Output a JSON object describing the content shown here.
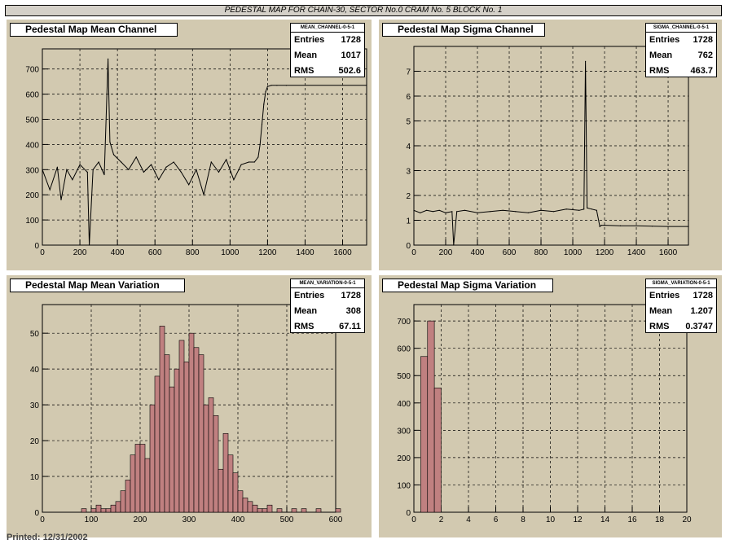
{
  "banner": "PEDESTAL MAP FOR CHAIN-30, SECTOR No.0 CRAM No. 5 BLOCK No. 1",
  "footer": "Printed: 12/31/2002",
  "colors": {
    "pad_bg": "#d2c9b0",
    "hist_fill": "#c08080",
    "line": "#000000"
  },
  "pads": [
    {
      "title": "Pedestal Map Mean Channel",
      "stats": {
        "name": "MEAN_CHANNEL-0-5-1",
        "entries_label": "Entries",
        "entries": "1728",
        "mean_label": "Mean",
        "mean": "1017",
        "rms_label": "RMS",
        "rms": "502.6"
      }
    },
    {
      "title": "Pedestal Map Sigma Channel",
      "stats": {
        "name": "SIGMA_CHANNEL-0-5-1",
        "entries_label": "Entries",
        "entries": "1728",
        "mean_label": "Mean",
        "mean": "762",
        "rms_label": "RMS",
        "rms": "463.7"
      }
    },
    {
      "title": "Pedestal Map Mean Variation",
      "stats": {
        "name": "MEAN_VARIATION-0-5-1",
        "entries_label": "Entries",
        "entries": "1728",
        "mean_label": "Mean",
        "mean": "308",
        "rms_label": "RMS",
        "rms": "67.11"
      }
    },
    {
      "title": "Pedestal Map Sigma Variation",
      "stats": {
        "name": "SIGMA_VARIATION-0-5-1",
        "entries_label": "Entries",
        "entries": "1728",
        "mean_label": "Mean",
        "mean": "1.207",
        "rms_label": "RMS",
        "rms": "0.3747"
      }
    }
  ],
  "chart_data": [
    {
      "type": "line",
      "title": "Pedestal Map Mean Channel",
      "xlim": [
        0,
        1728
      ],
      "ylim": [
        0,
        780
      ],
      "xticks": [
        0,
        200,
        400,
        600,
        800,
        1000,
        1200,
        1400,
        1600
      ],
      "yticks": [
        0,
        100,
        200,
        300,
        400,
        500,
        600,
        700
      ],
      "grid": true,
      "x": [
        0,
        40,
        80,
        100,
        130,
        160,
        200,
        240,
        250,
        270,
        300,
        330,
        350,
        360,
        380,
        420,
        460,
        500,
        540,
        580,
        620,
        660,
        700,
        740,
        780,
        820,
        860,
        900,
        940,
        980,
        1020,
        1060,
        1100,
        1130,
        1150,
        1160,
        1170,
        1180,
        1190,
        1200,
        1220,
        1250,
        1300,
        1728
      ],
      "y": [
        300,
        220,
        310,
        180,
        300,
        260,
        320,
        290,
        0,
        300,
        330,
        280,
        740,
        410,
        360,
        330,
        300,
        350,
        290,
        320,
        260,
        310,
        330,
        290,
        240,
        300,
        200,
        330,
        290,
        340,
        260,
        320,
        330,
        330,
        350,
        400,
        480,
        560,
        610,
        630,
        635,
        635,
        635,
        635
      ]
    },
    {
      "type": "line",
      "title": "Pedestal Map Sigma Channel",
      "xlim": [
        0,
        1728
      ],
      "ylim": [
        0,
        8
      ],
      "xticks": [
        0,
        200,
        400,
        600,
        800,
        1000,
        1200,
        1400,
        1600
      ],
      "yticks": [
        0,
        1,
        2,
        3,
        4,
        5,
        6,
        7
      ],
      "grid": true,
      "x": [
        0,
        40,
        80,
        120,
        160,
        200,
        240,
        250,
        270,
        320,
        400,
        480,
        560,
        640,
        720,
        800,
        880,
        960,
        1040,
        1070,
        1080,
        1090,
        1120,
        1150,
        1170,
        1180,
        1200,
        1300,
        1400,
        1500,
        1600,
        1728
      ],
      "y": [
        1.4,
        1.3,
        1.4,
        1.35,
        1.4,
        1.3,
        1.35,
        0,
        1.35,
        1.4,
        1.3,
        1.35,
        1.4,
        1.35,
        1.3,
        1.4,
        1.35,
        1.45,
        1.4,
        1.45,
        7.4,
        1.5,
        1.45,
        1.4,
        0.75,
        0.8,
        0.8,
        0.78,
        0.78,
        0.76,
        0.75,
        0.75
      ]
    },
    {
      "type": "bar",
      "title": "Pedestal Map Mean Variation",
      "xlim": [
        0,
        600
      ],
      "ylim": [
        0,
        58
      ],
      "xticks": [
        0,
        100,
        200,
        300,
        400,
        500,
        600
      ],
      "yticks": [
        0,
        10,
        20,
        30,
        40,
        50
      ],
      "grid": true,
      "bin_width": 10,
      "bin_start": [
        80,
        100,
        110,
        120,
        130,
        140,
        150,
        160,
        170,
        180,
        190,
        200,
        210,
        220,
        230,
        240,
        250,
        260,
        270,
        280,
        290,
        300,
        310,
        320,
        330,
        340,
        350,
        360,
        370,
        380,
        390,
        400,
        410,
        420,
        430,
        440,
        450,
        460,
        480,
        510,
        530,
        560,
        600
      ],
      "values": [
        1,
        1,
        2,
        1,
        1,
        2,
        3,
        6,
        9,
        16,
        19,
        19,
        15,
        30,
        38,
        52,
        44,
        35,
        40,
        48,
        42,
        50,
        46,
        44,
        30,
        32,
        27,
        12,
        22,
        16,
        11,
        6,
        4,
        3,
        2,
        1,
        1,
        2,
        1,
        1,
        1,
        1,
        1
      ]
    },
    {
      "type": "bar",
      "title": "Pedestal Map Sigma Variation",
      "xlim": [
        0,
        20
      ],
      "ylim": [
        0,
        760
      ],
      "xticks": [
        0,
        2,
        4,
        6,
        8,
        10,
        12,
        14,
        16,
        18,
        20
      ],
      "yticks": [
        0,
        100,
        200,
        300,
        400,
        500,
        600,
        700
      ],
      "grid": true,
      "bin_width": 0.5,
      "bin_start": [
        0.5,
        1.0,
        1.5
      ],
      "values": [
        570,
        700,
        455
      ]
    }
  ]
}
